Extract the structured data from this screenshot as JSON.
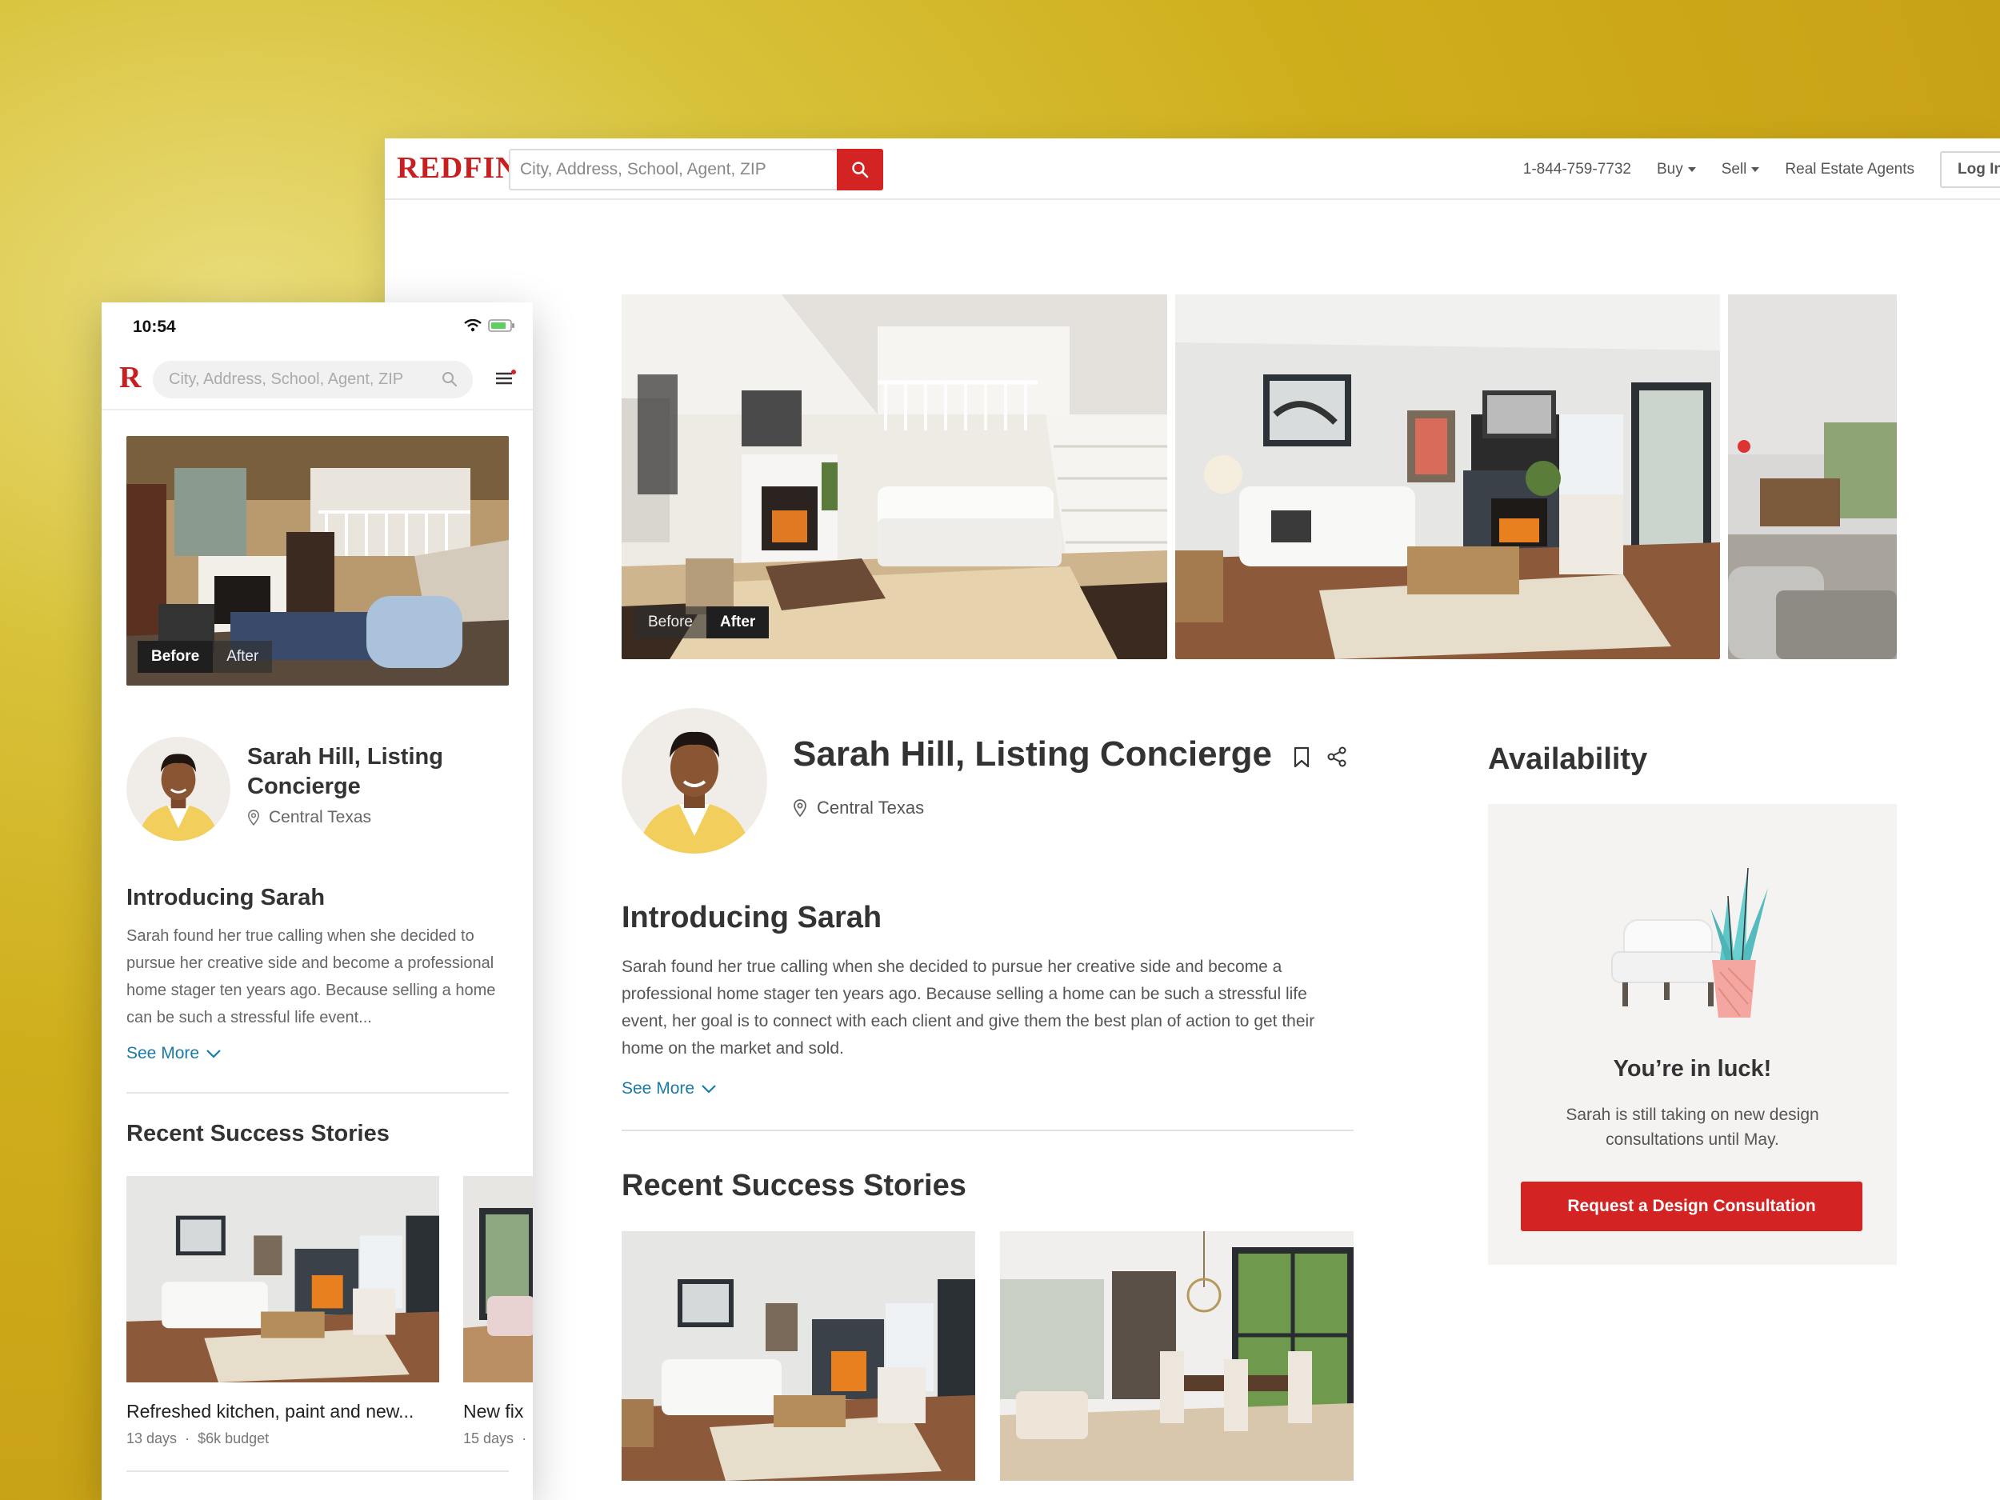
{
  "brand": {
    "name": "REDFIN",
    "mobile_mark": "R",
    "accent": "#d32323"
  },
  "desktop": {
    "nav": {
      "search_placeholder": "City, Address, School, Agent, ZIP",
      "phone": "1-844-759-7732",
      "buy": "Buy",
      "sell": "Sell",
      "agents": "Real Estate Agents",
      "login": "Log In"
    },
    "photo_toggle": {
      "before": "Before",
      "after": "After",
      "active": "after"
    },
    "profile": {
      "name": "Sarah Hill, Listing Concierge",
      "location": "Central Texas"
    },
    "intro": {
      "title": "Introducing Sarah",
      "bio": "Sarah found her true calling when she decided to pursue her creative side and become a professional home stager ten years ago. Because selling a home can be such a stressful life event, her goal is to connect with each client and give them the best plan of action to get their home on the market and sold.",
      "see_more": "See More"
    },
    "stories": {
      "title": "Recent Success Stories"
    },
    "availability": {
      "title": "Availability",
      "headline": "You’re in luck!",
      "message": "Sarah is still taking on new design consultations until May.",
      "cta": "Request a Design Consultation"
    }
  },
  "mobile": {
    "status": {
      "time": "10:54"
    },
    "search_placeholder": "City, Address, School, Agent, ZIP",
    "photo_toggle": {
      "before": "Before",
      "after": "After",
      "active": "before"
    },
    "profile": {
      "name": "Sarah Hill, Listing Concierge",
      "location": "Central Texas"
    },
    "intro": {
      "title": "Introducing Sarah",
      "bio": "Sarah found her true calling when she decided to pursue her creative side and become a professional home stager ten years ago. Because selling a home can be such a stressful life event...",
      "see_more": "See More"
    },
    "stories": {
      "title": "Recent Success Stories",
      "items": [
        {
          "title": "Refreshed kitchen, paint and new...",
          "days": "13 days",
          "budget": "$6k budget"
        },
        {
          "title": "New fix",
          "days": "15 days",
          "budget": ""
        }
      ]
    }
  }
}
